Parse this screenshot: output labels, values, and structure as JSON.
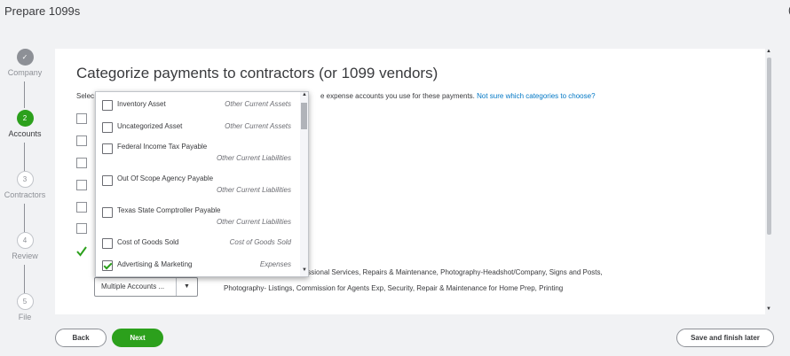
{
  "header": {
    "title": "Prepare 1099s",
    "corner": "("
  },
  "stepper": [
    {
      "number": "✓",
      "label": "Company",
      "state": "done"
    },
    {
      "number": "2",
      "label": "Accounts",
      "state": "active"
    },
    {
      "number": "3",
      "label": "Contractors",
      "state": "todo"
    },
    {
      "number": "4",
      "label": "Review",
      "state": "todo"
    },
    {
      "number": "5",
      "label": "File",
      "state": "todo"
    }
  ],
  "main": {
    "heading": "Categorize payments to contractors (or 1099 vendors)",
    "intro_pre": "Selec",
    "intro_post": "e expense accounts you use for these payments.",
    "intro_link": "Not sure which categories to choose?",
    "combo_value": "Multiple Accounts ...",
    "selected_categories": "Contractors, Legal & Professional Services, Repairs & Maintenance, Photography-Headshot/Company, Signs and Posts, Photography- Listings, Commission for Agents Exp, Security, Repair & Maintenance for Home Prep, Printing"
  },
  "dropdown": {
    "items": [
      {
        "name": "Inventory Asset",
        "type": "Other Current Assets",
        "checked": false
      },
      {
        "name": "Uncategorized Asset",
        "type": "Other Current Assets",
        "checked": false
      },
      {
        "name": "Federal Income Tax Payable",
        "type": "Other Current Liabilities",
        "checked": false
      },
      {
        "name": "Out Of Scope Agency Payable",
        "type": "Other Current Liabilities",
        "checked": false
      },
      {
        "name": "Texas State Comptroller Payable",
        "type": "Other Current Liabilities",
        "checked": false
      },
      {
        "name": "Cost of Goods Sold",
        "type": "Cost of Goods Sold",
        "checked": false
      },
      {
        "name": "Advertising & Marketing",
        "type": "Expenses",
        "checked": true
      }
    ]
  },
  "footer": {
    "back": "Back",
    "next": "Next",
    "save": "Save and finish later"
  },
  "colors": {
    "accent": "#2ca01c",
    "link": "#0077c5",
    "text": "#393a3d"
  }
}
